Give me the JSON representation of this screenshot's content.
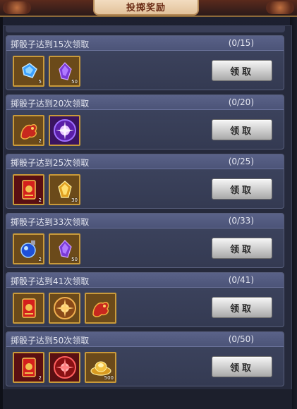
{
  "title": "投掷奖励",
  "claim_label": "领取",
  "rewards": [
    {
      "title": "掷骰子达到15次领取",
      "progress": "(0/15)",
      "items": [
        {
          "icon": "blue-gem-icon",
          "count": "5"
        },
        {
          "icon": "purple-crystal-icon",
          "count": "50"
        }
      ]
    },
    {
      "title": "掷骰子达到20次领取",
      "progress": "(0/20)",
      "items": [
        {
          "icon": "red-dragon-icon",
          "count": "2"
        },
        {
          "icon": "purple-orb-icon",
          "count": ""
        }
      ]
    },
    {
      "title": "掷骰子达到25次领取",
      "progress": "(0/25)",
      "items": [
        {
          "icon": "red-envelope-icon",
          "count": "2"
        },
        {
          "icon": "gold-crystal-icon",
          "count": "30"
        }
      ]
    },
    {
      "title": "掷骰子达到33次领取",
      "progress": "(0/33)",
      "items": [
        {
          "icon": "blue-potion-icon",
          "count": "2"
        },
        {
          "icon": "purple-crystal-icon",
          "count": "50"
        }
      ]
    },
    {
      "title": "掷骰子达到41次领取",
      "progress": "(0/41)",
      "items": [
        {
          "icon": "red-envelope-icon",
          "count": ""
        },
        {
          "icon": "gold-orb-icon",
          "count": ""
        },
        {
          "icon": "red-dragon-icon",
          "count": ""
        }
      ]
    },
    {
      "title": "掷骰子达到50次领取",
      "progress": "(0/50)",
      "items": [
        {
          "icon": "red-envelope-icon",
          "count": "2"
        },
        {
          "icon": "red-orb-icon",
          "count": ""
        },
        {
          "icon": "gold-ingot-icon",
          "count": "500"
        }
      ]
    }
  ]
}
